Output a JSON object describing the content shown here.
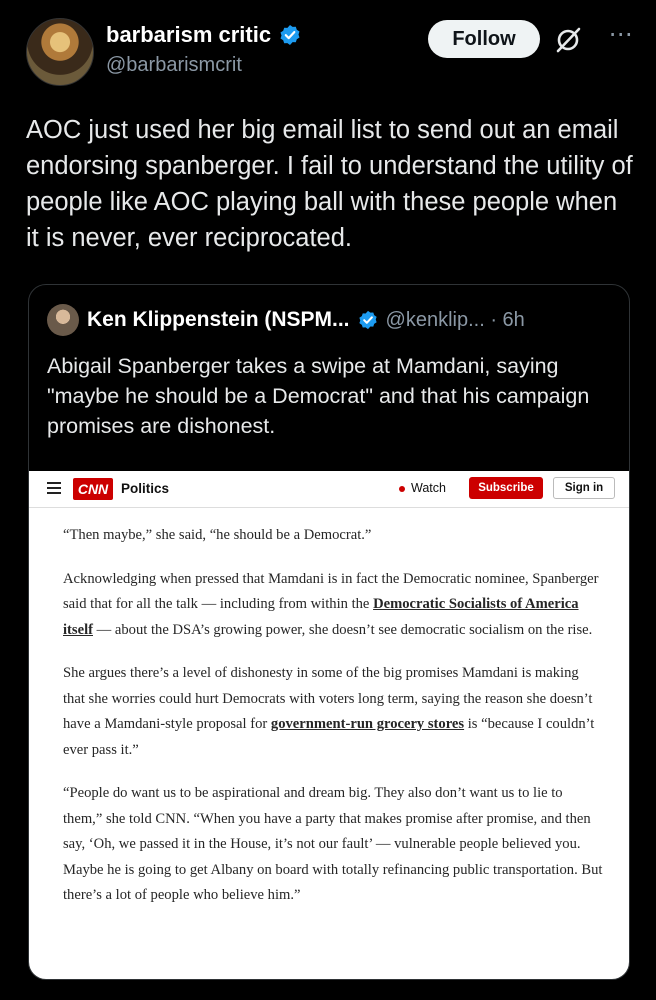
{
  "tweet": {
    "author": {
      "display_name": "barbarism critic",
      "handle": "@barbarismcrit"
    },
    "follow_label": "Follow",
    "text": "AOC just used her big email list to send out an email endorsing spanberger. I fail to understand the utility of people like AOC playing ball with these people when it is never, ever reciprocated."
  },
  "quote": {
    "author_name": "Ken Klippenstein (NSPM...",
    "handle_time": "@kenklip... · 6h",
    "text": "Abigail Spanberger takes a swipe at Mamdani, saying \"maybe he should be a Democrat\" and that his campaign promises are dishonest."
  },
  "article": {
    "nav": {
      "logo": "CNN",
      "section": "Politics",
      "watch": "Watch",
      "subscribe": "Subscribe",
      "signin": "Sign in"
    },
    "p1": "“Then maybe,” she said, “he should be a Democrat.”",
    "p2_pre": "Acknowledging when pressed that Mamdani is in fact the Democratic nominee, Spanberger said that for all the talk — including from within the ",
    "p2_link": "Democratic Socialists of America itself",
    "p2_post": " — about the DSA’s growing power, she doesn’t see democratic socialism on the rise.",
    "p3_pre": "She argues there’s a level of dishonesty in some of the big promises Mamdani is making that she worries could hurt Democrats with voters long term, saying the reason she doesn’t have a Mamdani-style proposal for ",
    "p3_link": "government-run grocery stores",
    "p3_post": " is “because I couldn’t ever pass it.”",
    "p4": "“People do want us to be aspirational and dream big. They also don’t want us to lie to them,” she told CNN. “When you have a party that makes promise after promise, and then say, ‘Oh, we passed it in the House, it’s not our fault’ — vulnerable people believed you. Maybe he is going to get Albany on board with totally refinancing public transportation. But there’s a lot of people who believe him.”"
  },
  "icons": {
    "verified": "verified-badge-icon",
    "grok": "grok-icon",
    "more": "more-icon",
    "menu": "menu-icon"
  },
  "colors": {
    "background": "#000000",
    "verified": "#1d9bf0",
    "cnn_red": "#cc0000",
    "secondary_text": "#8b98a5"
  }
}
